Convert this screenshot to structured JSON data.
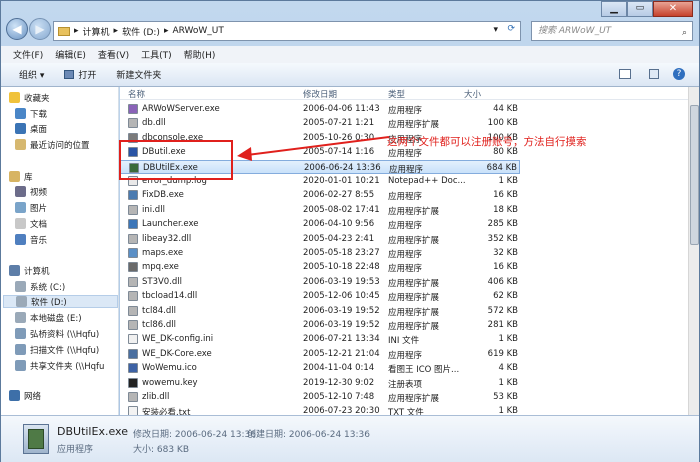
{
  "address": {
    "crumbs": [
      "计算机",
      "软件 (D:)",
      "ARWoW_UT"
    ],
    "search_placeholder": "搜索 ARWoW_UT"
  },
  "menu": [
    "文件(F)",
    "编辑(E)",
    "查看(V)",
    "工具(T)",
    "帮助(H)"
  ],
  "toolbar": {
    "organize": "组织 ▾",
    "open": "打开",
    "new_folder": "新建文件夹"
  },
  "sidebar": {
    "favorites": "收藏夹",
    "fav_items": [
      "下载",
      "桌面",
      "最近访问的位置"
    ],
    "libraries": "库",
    "lib_items": [
      "视频",
      "图片",
      "文档",
      "音乐"
    ],
    "computer": "计算机",
    "drives": [
      "系统 (C:)",
      "软件 (D:)",
      "本地磁盘 (E:)",
      "弘桥资料 (\\\\Hqfu)",
      "扫描文件 (\\\\Hqfu)",
      "共享文件夹 (\\\\Hqfu"
    ],
    "network": "网络"
  },
  "columns": {
    "name": "名称",
    "date": "修改日期",
    "type": "类型",
    "size": "大小"
  },
  "files": [
    {
      "name": "ARWoWServer.exe",
      "date": "2006-04-06 11:43",
      "type": "应用程序",
      "size": "44 KB"
    },
    {
      "name": "db.dll",
      "date": "2005-07-21 1:21",
      "type": "应用程序扩展",
      "size": "100 KB"
    },
    {
      "name": "dbconsole.exe",
      "date": "2005-10-26 0:30",
      "type": "应用程序",
      "size": "100 KB"
    },
    {
      "name": "DButil.exe",
      "date": "2005-07-14 1:16",
      "type": "应用程序",
      "size": "80 KB"
    },
    {
      "name": "DBUtilEx.exe",
      "date": "2006-06-24 13:36",
      "type": "应用程序",
      "size": "684 KB"
    },
    {
      "name": "error_dump.log",
      "date": "2020-01-01 10:21",
      "type": "Notepad++ Doc...",
      "size": "1 KB"
    },
    {
      "name": "FixDB.exe",
      "date": "2006-02-27 8:55",
      "type": "应用程序",
      "size": "16 KB"
    },
    {
      "name": "ini.dll",
      "date": "2005-08-02 17:41",
      "type": "应用程序扩展",
      "size": "18 KB"
    },
    {
      "name": "Launcher.exe",
      "date": "2006-04-10 9:56",
      "type": "应用程序",
      "size": "285 KB"
    },
    {
      "name": "libeay32.dll",
      "date": "2005-04-23 2:41",
      "type": "应用程序扩展",
      "size": "352 KB"
    },
    {
      "name": "maps.exe",
      "date": "2005-05-18 23:27",
      "type": "应用程序",
      "size": "32 KB"
    },
    {
      "name": "mpq.exe",
      "date": "2005-10-18 22:48",
      "type": "应用程序",
      "size": "16 KB"
    },
    {
      "name": "ST3V0.dll",
      "date": "2006-03-19 19:53",
      "type": "应用程序扩展",
      "size": "406 KB"
    },
    {
      "name": "tbcload14.dll",
      "date": "2005-12-06 10:45",
      "type": "应用程序扩展",
      "size": "62 KB"
    },
    {
      "name": "tcl84.dll",
      "date": "2006-03-19 19:52",
      "type": "应用程序扩展",
      "size": "572 KB"
    },
    {
      "name": "tcl86.dll",
      "date": "2006-03-19 19:52",
      "type": "应用程序扩展",
      "size": "281 KB"
    },
    {
      "name": "WE_DK-config.ini",
      "date": "2006-07-21 13:34",
      "type": "INI 文件",
      "size": "1 KB"
    },
    {
      "name": "WE_DK-Core.exe",
      "date": "2005-12-21 21:04",
      "type": "应用程序",
      "size": "619 KB"
    },
    {
      "name": "WoWemu.ico",
      "date": "2004-11-04 0:14",
      "type": "看图王 ICO 图片...",
      "size": "4 KB"
    },
    {
      "name": "wowemu.key",
      "date": "2019-12-30 9:02",
      "type": "注册表项",
      "size": "1 KB"
    },
    {
      "name": "zlib.dll",
      "date": "2005-12-10 7:48",
      "type": "应用程序扩展",
      "size": "53 KB"
    },
    {
      "name": "安装必看.txt",
      "date": "2006-07-23 20:30",
      "type": "TXT 文件",
      "size": "1 KB"
    }
  ],
  "selected_index": 4,
  "details": {
    "name": "DBUtilEx.exe",
    "modified_label": "修改日期: 2006-06-24 13:36",
    "created_label": "创建日期: 2006-06-24 13:36",
    "type": "应用程序",
    "size_label": "大小: 683 KB"
  },
  "annotation": "这两个文件都可以注册账号，方法自行摸索",
  "colors": {
    "annotation": "#e0201c",
    "selection": "#c9e1fa"
  }
}
